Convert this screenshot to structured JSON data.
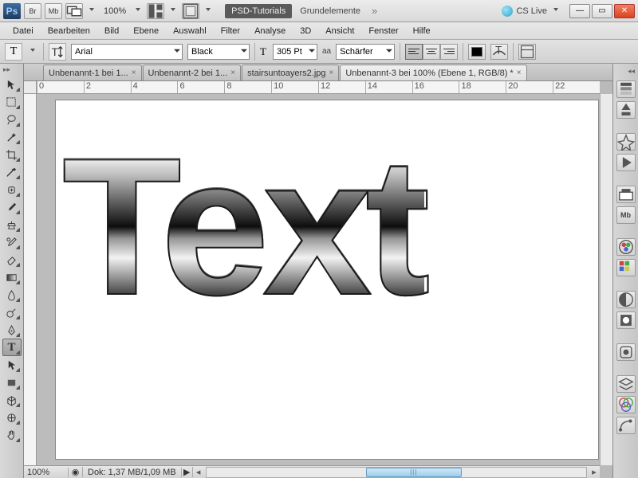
{
  "titlebar": {
    "logo": "Ps",
    "br": "Br",
    "mb": "Mb",
    "zoom": "100%",
    "psd_tut": "PSD-Tutorials",
    "grund": "Grundelemente",
    "cslive": "CS Live"
  },
  "menu": [
    "Datei",
    "Bearbeiten",
    "Bild",
    "Ebene",
    "Auswahl",
    "Filter",
    "Analyse",
    "3D",
    "Ansicht",
    "Fenster",
    "Hilfe"
  ],
  "options": {
    "tool_glyph": "T",
    "font_family": "Arial",
    "font_style": "Black",
    "font_size": "305 Pt",
    "aa_label": "aa",
    "aa_mode": "Schärfer"
  },
  "tabs": [
    {
      "label": "Unbenannt-1 bei 1...",
      "active": false
    },
    {
      "label": "Unbenannt-2 bei 1...",
      "active": false
    },
    {
      "label": "stairsuntoayers2.jpg",
      "active": false
    },
    {
      "label": "Unbenannt-3 bei 100% (Ebene 1, RGB/8) *",
      "active": true
    }
  ],
  "ruler_h": [
    "0",
    "2",
    "4",
    "6",
    "8",
    "10",
    "12",
    "14",
    "16",
    "18",
    "20",
    "22"
  ],
  "canvas_text": "Text",
  "status": {
    "zoom": "100%",
    "dok": "Dok: 1,37 MB/1,09 MB"
  }
}
